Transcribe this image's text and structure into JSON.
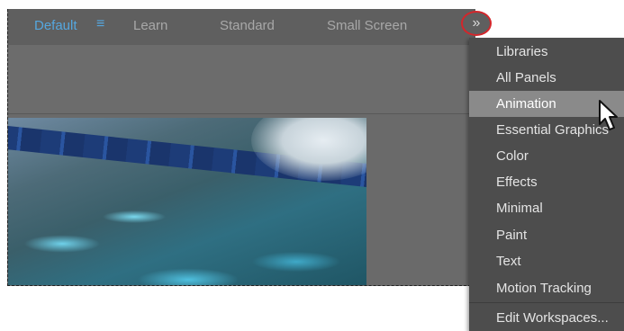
{
  "workspace_bar": {
    "tabs": [
      {
        "label": "Default",
        "active": true
      },
      {
        "label": "Learn",
        "active": false
      },
      {
        "label": "Standard",
        "active": false
      },
      {
        "label": "Small Screen",
        "active": false
      }
    ],
    "overflow_label": "»"
  },
  "workspace_menu": {
    "items": [
      "Libraries",
      "All Panels",
      "Animation",
      "Essential Graphics",
      "Color",
      "Effects",
      "Minimal",
      "Paint",
      "Text",
      "Motion Tracking"
    ],
    "highlighted": "Animation",
    "footer_item": "Edit Workspaces..."
  },
  "colors": {
    "accent": "#55a7df",
    "highlight_ring": "#d4262b",
    "menu_bg": "#4d4d4d",
    "menu_highlight": "#8a8a8a"
  },
  "icons": [
    "menu-icon",
    "chevron-double-right-icon",
    "pointer-cursor-icon"
  ]
}
